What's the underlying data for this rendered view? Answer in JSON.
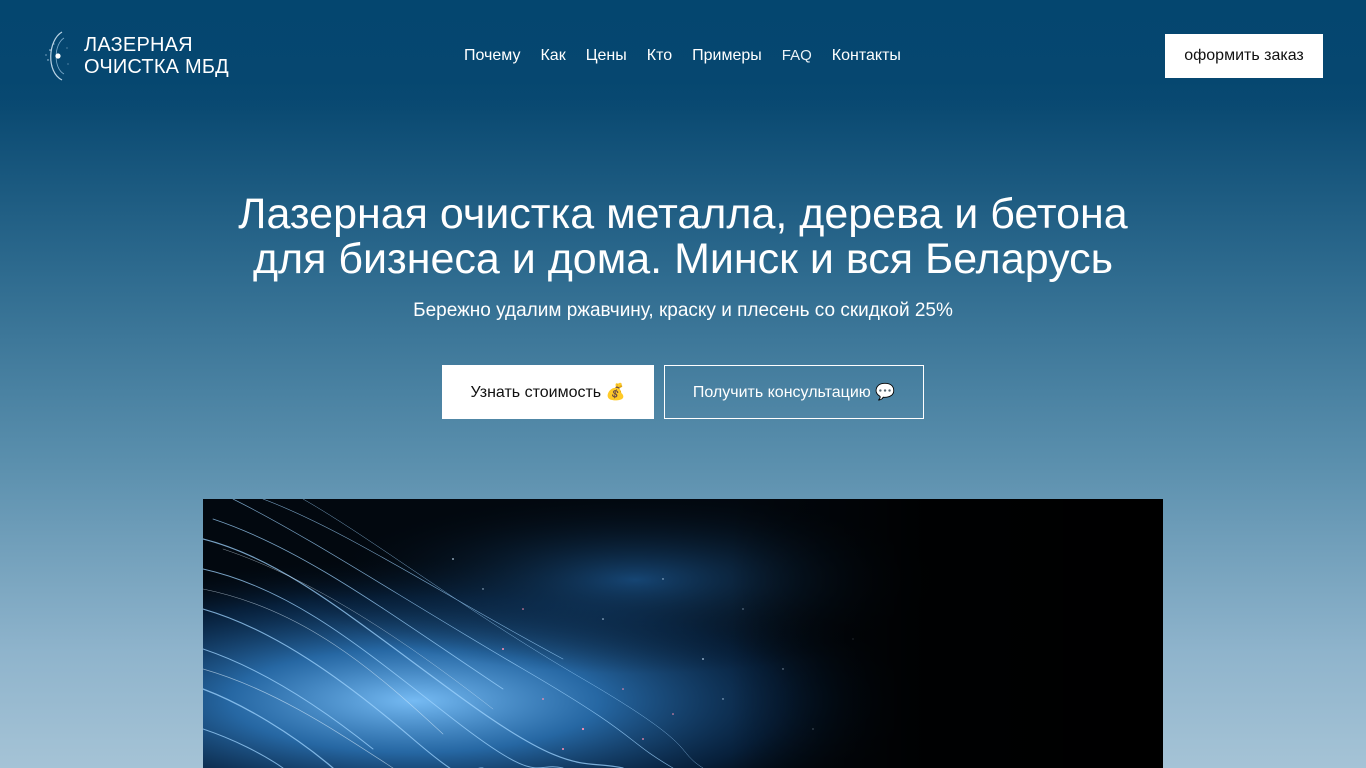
{
  "header": {
    "logo": {
      "line1": "ЛАЗЕРНАЯ",
      "line2": "ОЧИСТКА МБД",
      "icon": "laser-eye-icon"
    },
    "nav": [
      {
        "label": "Почему"
      },
      {
        "label": "Как"
      },
      {
        "label": "Цены"
      },
      {
        "label": "Кто"
      },
      {
        "label": "Примеры"
      },
      {
        "label": "FAQ"
      },
      {
        "label": "Контакты"
      }
    ],
    "order_button": "оформить заказ"
  },
  "hero": {
    "title_line1": "Лазерная очистка металла, дерева и бетона",
    "title_line2": "для бизнеса и дома. Минск и вся Беларусь",
    "subtitle": "Бережно удалим ржавчину, краску и плесень со скидкой 25%",
    "primary_button": "Узнать стоимость 💰",
    "secondary_button": "Получить консультацию 💬",
    "image": "blue-sparks-laser-photo"
  },
  "colors": {
    "header_bg": "#04466f",
    "gradient_bottom": "#a5c3d6",
    "button_bg": "#ffffff",
    "button_text": "#111111"
  }
}
